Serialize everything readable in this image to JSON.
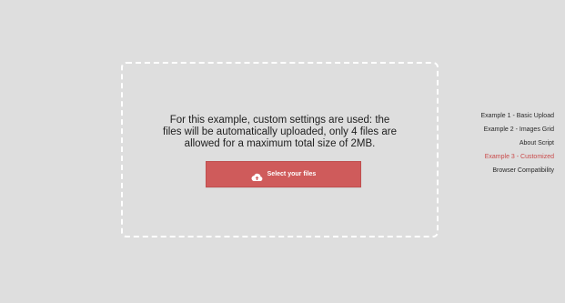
{
  "uploader": {
    "instructions": "For this example, custom settings are used: the files will be automatically uploaded, only 4 files are allowed for a maximum total size of 2MB.",
    "button_icon": "cloud-upload-icon",
    "button_label": "Select your files"
  },
  "nav": {
    "items": [
      {
        "label": "Example 1 - Basic Upload",
        "active": false
      },
      {
        "label": "Example 2 - Images Grid",
        "active": false
      },
      {
        "label": "About Script",
        "active": false
      },
      {
        "label": "Example 3 - Customized",
        "active": true
      },
      {
        "label": "Browser Compatibility",
        "active": false
      }
    ]
  },
  "colors": {
    "background": "#dedede",
    "accent": "#cf5b5b",
    "active_nav": "#c94a4a"
  }
}
